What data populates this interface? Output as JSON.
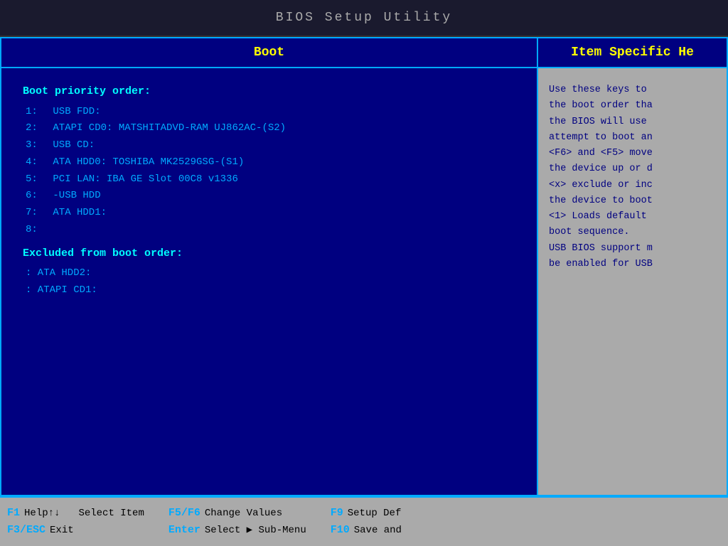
{
  "title": "BIOS Setup Utility",
  "header": {
    "boot_label": "Boot",
    "help_label": "Item Specific He"
  },
  "boot": {
    "priority_title": "Boot priority order:",
    "items": [
      {
        "num": "1:",
        "label": "USB FDD:"
      },
      {
        "num": "2:",
        "label": "ATAPI CD0: MATSHITADVD-RAM UJ862AC-(S2)"
      },
      {
        "num": "3:",
        "label": "USB CD:"
      },
      {
        "num": "4:",
        "label": "ATA HDD0: TOSHIBA MK2529GSG-(S1)"
      },
      {
        "num": "5:",
        "label": "PCI LAN:  IBA GE Slot 00C8 v1336"
      },
      {
        "num": "6:",
        "label": "-USB HDD"
      },
      {
        "num": "7:",
        "label": "ATA HDD1:"
      },
      {
        "num": "8:",
        "label": ""
      }
    ],
    "excluded_title": "Excluded from boot order:",
    "excluded_items": [
      {
        "label": ": ATA HDD2:"
      },
      {
        "label": ": ATAPI CD1:"
      }
    ]
  },
  "help_text": [
    "Use these keys to",
    "the boot order tha",
    "the BIOS will use",
    "attempt to boot an",
    "<F6> and <F5> move",
    "the device up or d",
    "<x> exclude or inc",
    "the device to boot",
    "<1> Loads default",
    "boot sequence.",
    "USB BIOS support m",
    "be enabled for USB"
  ],
  "footer": {
    "f1_key": "F1",
    "f1_desc1": "Help↑↓",
    "f1_desc2": "Select Item",
    "f3_key": "F3/ESC",
    "f3_desc": "Exit",
    "f5f6_key": "F5/F6",
    "f5f6_desc": "Change Values",
    "enter_key": "Enter",
    "enter_desc": "Select ▶ Sub-Menu",
    "f9_key": "F9",
    "f9_desc": "Setup Def",
    "f10_key": "F10",
    "f10_desc": "Save and"
  }
}
